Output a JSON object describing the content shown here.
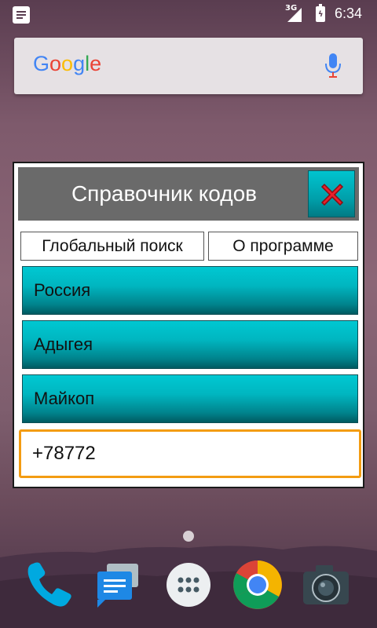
{
  "status_bar": {
    "network_type": "3G",
    "time": "6:34"
  },
  "google_bar": {
    "logo_text": [
      "G",
      "o",
      "o",
      "g",
      "l",
      "e"
    ],
    "logo_colors": [
      "#4285F4",
      "#EA4335",
      "#FBBC05",
      "#4285F4",
      "#34A853",
      "#EA4335"
    ]
  },
  "dialog": {
    "title": "Справочник кодов",
    "tabs": {
      "global_search": "Глобальный поиск",
      "about": "О программе"
    },
    "items": [
      "Россия",
      "Адыгея",
      "Майкоп"
    ],
    "code_value": "+78772"
  },
  "colors": {
    "accent_teal": "#00b6c0",
    "focus_orange": "#f39c12",
    "title_gray": "#6a6a6a"
  },
  "dock": {
    "icons": [
      "phone-icon",
      "messaging-icon",
      "app-drawer-icon",
      "chrome-icon",
      "camera-icon"
    ]
  }
}
